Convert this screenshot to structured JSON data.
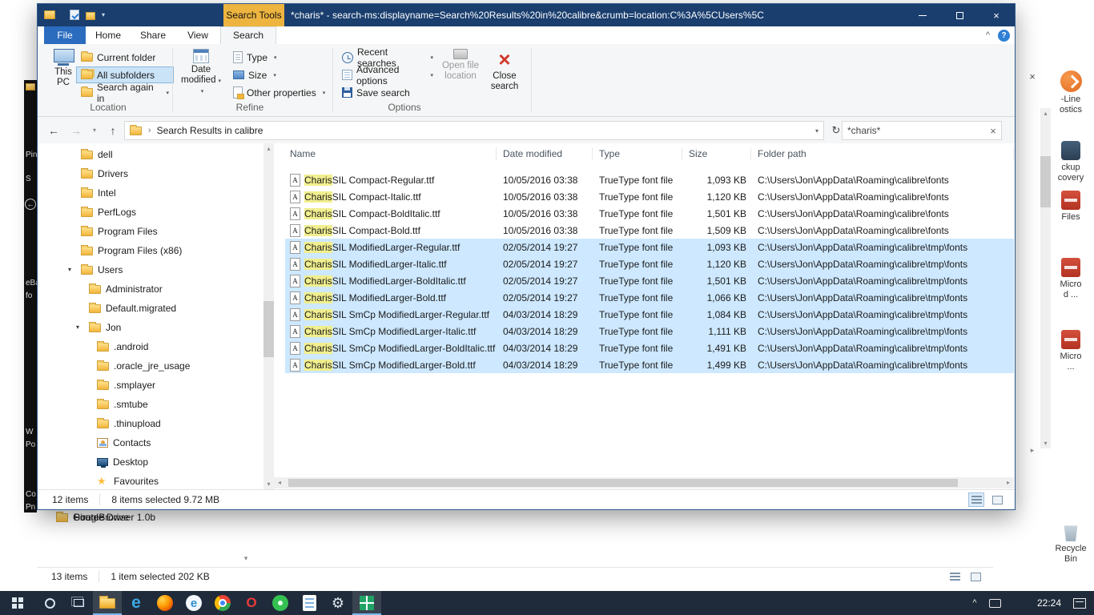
{
  "window": {
    "search_tools": "Search Tools",
    "title": "*charis* - search-ms:displayname=Search%20Results%20in%20calibre&crumb=location:C%3A%5CUsers%5C"
  },
  "icons": {
    "minimize": "–",
    "maximize": "window-outline",
    "close": "×",
    "back": "←",
    "forward": "→",
    "up": "↑",
    "refresh": "↻",
    "dropdown": "▾",
    "breadcrumb_arrow": "›",
    "clear": "×",
    "help": "?",
    "collapse_ribbon": "^",
    "scroll_up": "▴",
    "scroll_down": "▾",
    "scroll_left": "◂",
    "scroll_right": "▸",
    "tray_chevron": "^"
  },
  "ribbon": {
    "tabs": [
      {
        "label": "File",
        "name": "tab-file",
        "cls": "file"
      },
      {
        "label": "Home",
        "name": "tab-home"
      },
      {
        "label": "Share",
        "name": "tab-share"
      },
      {
        "label": "View",
        "name": "tab-view"
      },
      {
        "label": "Search",
        "name": "tab-search",
        "active": true
      }
    ],
    "location": {
      "label": "Location",
      "this_pc_1": "This",
      "this_pc_2": "PC",
      "current_folder": "Current folder",
      "all_subfolders": "All subfolders",
      "search_again": "Search again in"
    },
    "refine": {
      "label": "Refine",
      "date_1": "Date",
      "date_2": "modified",
      "type": "Type",
      "size": "Size",
      "other": "Other properties"
    },
    "options": {
      "label": "Options",
      "recent": "Recent searches",
      "advanced": "Advanced options",
      "save": "Save search",
      "open_1": "Open file",
      "open_2": "location",
      "close_1": "Close",
      "close_2": "search"
    }
  },
  "address": {
    "breadcrumb": "Search Results in calibre",
    "search_value": "*charis*"
  },
  "nav": {
    "items": [
      {
        "label": "dell",
        "icon": "folder",
        "indent": 0
      },
      {
        "label": "Drivers",
        "icon": "folder",
        "indent": 0
      },
      {
        "label": "Intel",
        "icon": "folder",
        "indent": 0
      },
      {
        "label": "PerfLogs",
        "icon": "folder",
        "indent": 0
      },
      {
        "label": "Program Files",
        "icon": "folder",
        "indent": 0
      },
      {
        "label": "Program Files (x86)",
        "icon": "folder",
        "indent": 0
      },
      {
        "label": "Users",
        "icon": "folder",
        "indent": 0,
        "expanded": true
      },
      {
        "label": "Administrator",
        "icon": "folder",
        "indent": 1
      },
      {
        "label": "Default.migrated",
        "icon": "folder",
        "indent": 1
      },
      {
        "label": "Jon",
        "icon": "folder",
        "indent": 1,
        "expanded": true
      },
      {
        "label": ".android",
        "icon": "folder",
        "indent": 2
      },
      {
        "label": ".oracle_jre_usage",
        "icon": "folder",
        "indent": 2
      },
      {
        "label": ".smplayer",
        "icon": "folder",
        "indent": 2
      },
      {
        "label": ".smtube",
        "icon": "folder",
        "indent": 2
      },
      {
        "label": ".thinupload",
        "icon": "folder",
        "indent": 2
      },
      {
        "label": "Contacts",
        "icon": "contacts",
        "indent": 2
      },
      {
        "label": "Desktop",
        "icon": "desktop",
        "indent": 2
      },
      {
        "label": "Favourites",
        "icon": "favourites",
        "indent": 2
      }
    ]
  },
  "files": {
    "columns": [
      "Name",
      "Date modified",
      "Type",
      "Size",
      "Folder path"
    ],
    "rows": [
      {
        "hl": "Charis",
        "name": " SIL Compact-Regular.ttf",
        "date": "10/05/2016 03:38",
        "type": "TrueType font file",
        "size": "1,093 KB",
        "path": "C:\\Users\\Jon\\AppData\\Roaming\\calibre\\fonts"
      },
      {
        "hl": "Charis",
        "name": " SIL Compact-Italic.ttf",
        "date": "10/05/2016 03:38",
        "type": "TrueType font file",
        "size": "1,120 KB",
        "path": "C:\\Users\\Jon\\AppData\\Roaming\\calibre\\fonts"
      },
      {
        "hl": "Charis",
        "name": " SIL Compact-BoldItalic.ttf",
        "date": "10/05/2016 03:38",
        "type": "TrueType font file",
        "size": "1,501 KB",
        "path": "C:\\Users\\Jon\\AppData\\Roaming\\calibre\\fonts"
      },
      {
        "hl": "Charis",
        "name": " SIL Compact-Bold.ttf",
        "date": "10/05/2016 03:38",
        "type": "TrueType font file",
        "size": "1,509 KB",
        "path": "C:\\Users\\Jon\\AppData\\Roaming\\calibre\\fonts"
      },
      {
        "hl": "Charis",
        "name": " SIL ModifiedLarger-Regular.ttf",
        "date": "02/05/2014 19:27",
        "type": "TrueType font file",
        "size": "1,093 KB",
        "path": "C:\\Users\\Jon\\AppData\\Roaming\\calibre\\tmp\\fonts",
        "selected": true
      },
      {
        "hl": "Charis",
        "name": " SIL ModifiedLarger-Italic.ttf",
        "date": "02/05/2014 19:27",
        "type": "TrueType font file",
        "size": "1,120 KB",
        "path": "C:\\Users\\Jon\\AppData\\Roaming\\calibre\\tmp\\fonts",
        "selected": true
      },
      {
        "hl": "Charis",
        "name": " SIL ModifiedLarger-BoldItalic.ttf",
        "date": "02/05/2014 19:27",
        "type": "TrueType font file",
        "size": "1,501 KB",
        "path": "C:\\Users\\Jon\\AppData\\Roaming\\calibre\\tmp\\fonts",
        "selected": true
      },
      {
        "hl": "Charis",
        "name": " SIL ModifiedLarger-Bold.ttf",
        "date": "02/05/2014 19:27",
        "type": "TrueType font file",
        "size": "1,066 KB",
        "path": "C:\\Users\\Jon\\AppData\\Roaming\\calibre\\tmp\\fonts",
        "selected": true
      },
      {
        "hl": "Charis",
        "name": " SIL SmCp ModifiedLarger-Regular.ttf",
        "date": "04/03/2014 18:29",
        "type": "TrueType font file",
        "size": "1,084 KB",
        "path": "C:\\Users\\Jon\\AppData\\Roaming\\calibre\\tmp\\fonts",
        "selected": true
      },
      {
        "hl": "Charis",
        "name": " SIL SmCp ModifiedLarger-Italic.ttf",
        "date": "04/03/2014 18:29",
        "type": "TrueType font file",
        "size": "1,111 KB",
        "path": "C:\\Users\\Jon\\AppData\\Roaming\\calibre\\tmp\\fonts",
        "selected": true
      },
      {
        "hl": "Charis",
        "name": " SIL SmCp ModifiedLarger-BoldItalic.ttf",
        "date": "04/03/2014 18:29",
        "type": "TrueType font file",
        "size": "1,491 KB",
        "path": "C:\\Users\\Jon\\AppData\\Roaming\\calibre\\tmp\\fonts",
        "selected": true
      },
      {
        "hl": "Charis",
        "name": " SIL SmCp ModifiedLarger-Bold.ttf",
        "date": "04/03/2014 18:29",
        "type": "TrueType font file",
        "size": "1,499 KB",
        "path": "C:\\Users\\Jon\\AppData\\Roaming\\calibre\\tmp\\fonts",
        "selected": true
      }
    ]
  },
  "status": {
    "count": "12 items",
    "selection": "8 items selected 9.72 MB"
  },
  "background_window": {
    "items": [
      {
        "label": "Google Drive",
        "icon": "gdrive",
        "name": "bg-item-google-drive"
      },
      {
        "label": "PirateBrowser 1.0b",
        "icon": "folder",
        "name": "bg-item-piratebrowser"
      },
      {
        "label": "Source",
        "icon": "folder",
        "name": "bg-item-source"
      }
    ],
    "status_count": "13 items",
    "status_selection": "1 item selected 202 KB"
  },
  "desktop": {
    "left_fragments": [
      "Pin",
      "S",
      "eBa",
      "fo",
      "W",
      "Po",
      "Co",
      "Pn"
    ],
    "right_icons": [
      {
        "name": "desktop-icon-eline",
        "label1": "-Line",
        "label2": "ostics",
        "icon": "orange-app"
      },
      {
        "name": "desktop-icon-backup",
        "label1": "ckup",
        "label2": "covery",
        "icon": "dark-app"
      },
      {
        "name": "desktop-icon-files",
        "label1": "Files",
        "label2": "",
        "icon": "red-app"
      },
      {
        "name": "desktop-icon-micro-1",
        "label1": "Micro",
        "label2": "d ...",
        "icon": "red-app"
      },
      {
        "name": "desktop-icon-micro-2",
        "label1": "Micro",
        "label2": "...",
        "icon": "red-app"
      },
      {
        "name": "desktop-icon-recycle-bin",
        "label1": "Recycle Bin",
        "label2": "",
        "icon": "recycle"
      }
    ]
  },
  "taskbar": {
    "time": "22:24",
    "apps": [
      {
        "name": "start-button",
        "icon": "start"
      },
      {
        "name": "search-button",
        "icon": "search"
      },
      {
        "name": "task-view-button",
        "icon": "taskview"
      },
      {
        "name": "taskbar-file-explorer",
        "icon": "explorer",
        "active": true
      },
      {
        "name": "taskbar-edge",
        "icon": "edge"
      },
      {
        "name": "taskbar-firefox",
        "icon": "firefox"
      },
      {
        "name": "taskbar-internet-explorer",
        "icon": "ie"
      },
      {
        "name": "taskbar-chrome",
        "icon": "chrome"
      },
      {
        "name": "taskbar-opera",
        "icon": "opera"
      },
      {
        "name": "taskbar-green-app",
        "icon": "greenapp"
      },
      {
        "name": "taskbar-notes-app",
        "icon": "notesapp"
      },
      {
        "name": "taskbar-settings",
        "icon": "settings"
      },
      {
        "name": "taskbar-green-grid-app",
        "icon": "greengrid",
        "active": true
      }
    ]
  }
}
